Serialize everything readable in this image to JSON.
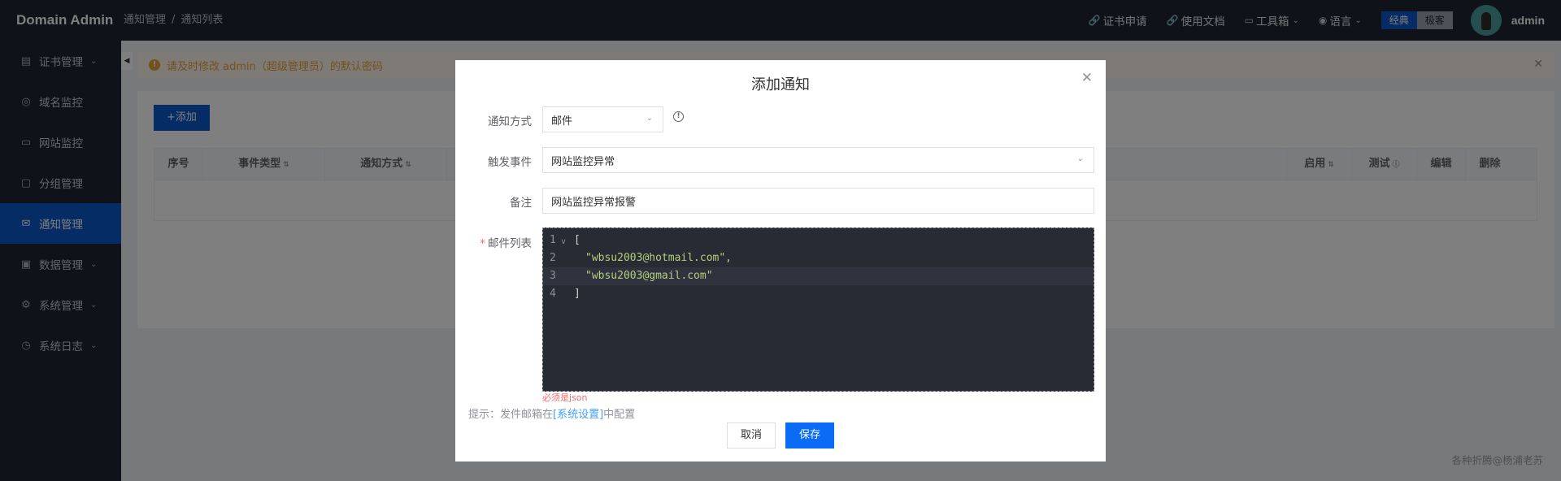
{
  "header": {
    "brand": "Domain Admin",
    "breadcrumb": [
      "通知管理",
      "通知列表"
    ],
    "breadcrumb_sep": "/",
    "nav": [
      {
        "label": "证书申请",
        "icon": "link-icon"
      },
      {
        "label": "使用文档",
        "icon": "link-icon"
      },
      {
        "label": "工具箱",
        "icon": "toolbox-icon",
        "dropdown": true
      },
      {
        "label": "语言",
        "icon": "location-icon",
        "dropdown": true
      }
    ],
    "theme": {
      "classic": "经典",
      "minimal": "极客",
      "selected": "经典"
    },
    "username": "admin"
  },
  "sidebar": {
    "items": [
      {
        "label": "证书管理",
        "icon": "document-icon",
        "expandable": true
      },
      {
        "label": "域名监控",
        "icon": "database-icon"
      },
      {
        "label": "网站监控",
        "icon": "monitor-icon"
      },
      {
        "label": "分组管理",
        "icon": "briefcase-icon"
      },
      {
        "label": "通知管理",
        "icon": "mail-icon",
        "active": true
      },
      {
        "label": "数据管理",
        "icon": "bag-icon",
        "expandable": true
      },
      {
        "label": "系统管理",
        "icon": "gear-icon",
        "expandable": true
      },
      {
        "label": "系统日志",
        "icon": "clock-icon",
        "expandable": true
      }
    ]
  },
  "alert": {
    "text": "请及时修改 admin（超级管理员）的默认密码"
  },
  "list": {
    "add_label": "+添加",
    "columns": [
      "序号",
      "事件类型",
      "通知方式",
      "启用",
      "测试",
      "编辑",
      "删除"
    ]
  },
  "dialog": {
    "title": "添加通知",
    "fields": {
      "method": {
        "label": "通知方式",
        "value": "邮件"
      },
      "event": {
        "label": "触发事件",
        "value": "网站监控异常"
      },
      "remark": {
        "label": "备注",
        "value": "网站监控异常报警"
      },
      "email_list": {
        "label": "邮件列表",
        "required": true,
        "lines": [
          "[",
          "\"wbsu2003@hotmail.com\",",
          "\"wbsu2003@gmail.com\"",
          "]"
        ],
        "line_numbers": [
          "1",
          "2",
          "3",
          "4"
        ],
        "error": "必须是json"
      }
    },
    "tip_prefix": "提示：发件邮箱在",
    "tip_link": "[系统设置]",
    "tip_suffix": "中配置",
    "cancel_label": "取消",
    "save_label": "保存"
  },
  "watermark": "各种折腾@杨浦老苏",
  "colors": {
    "accent": "#0a58ca",
    "sidebar_bg": "#1f2430",
    "warning": "#e6a23c",
    "error": "#f56c6c",
    "link": "#409eff"
  }
}
